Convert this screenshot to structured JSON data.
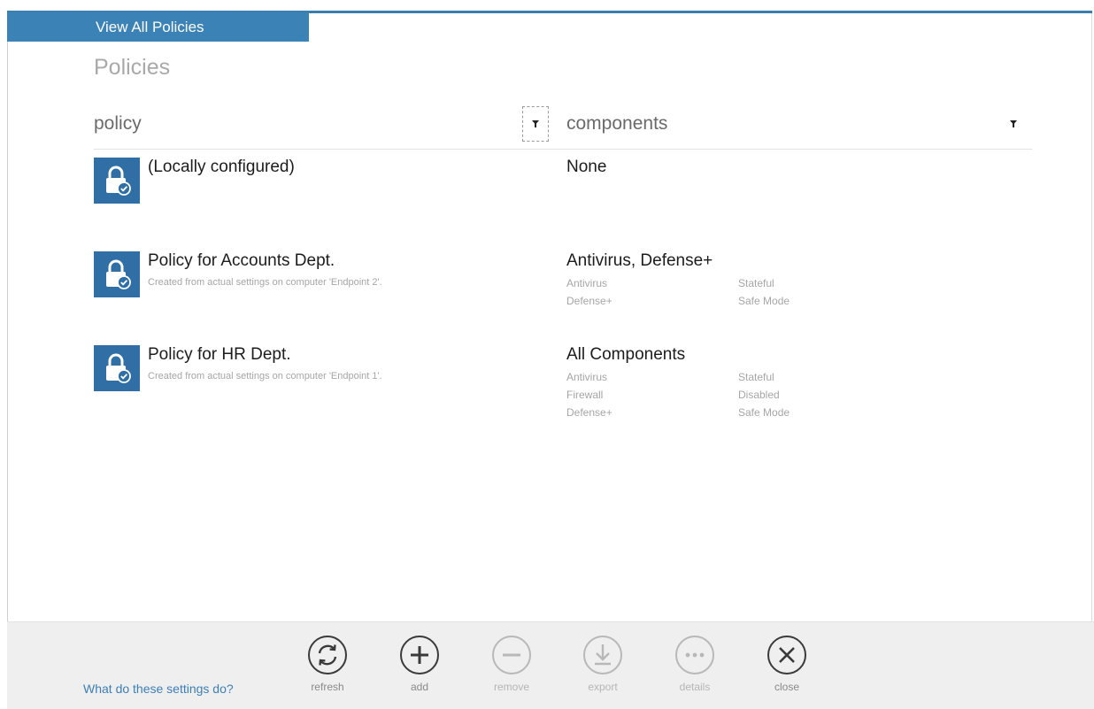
{
  "tab": {
    "label": "View All Policies"
  },
  "page": {
    "title": "Policies"
  },
  "columns": {
    "policy": "policy",
    "components": "components"
  },
  "policies": [
    {
      "name": "(Locally configured)",
      "subtitle": "",
      "components_summary": "None",
      "components": []
    },
    {
      "name": "Policy for Accounts Dept.",
      "subtitle": "Created from actual settings on computer 'Endpoint 2'.",
      "components_summary": "Antivirus, Defense+",
      "components": [
        {
          "name": "Antivirus",
          "state": "Stateful"
        },
        {
          "name": "Defense+",
          "state": "Safe Mode"
        }
      ]
    },
    {
      "name": "Policy for HR Dept.",
      "subtitle": "Created from actual settings on computer 'Endpoint 1'.",
      "components_summary": "All Components",
      "components": [
        {
          "name": "Antivirus",
          "state": "Stateful"
        },
        {
          "name": "Firewall",
          "state": "Disabled"
        },
        {
          "name": "Defense+",
          "state": "Safe Mode"
        }
      ]
    }
  ],
  "footer": {
    "help_link": "What do these settings do?",
    "actions": {
      "refresh": {
        "label": "refresh",
        "icon": "refresh-icon",
        "enabled": true
      },
      "add": {
        "label": "add",
        "icon": "plus-icon",
        "enabled": true
      },
      "remove": {
        "label": "remove",
        "icon": "minus-icon",
        "enabled": false
      },
      "export": {
        "label": "export",
        "icon": "download-icon",
        "enabled": false
      },
      "details": {
        "label": "details",
        "icon": "ellipsis-icon",
        "enabled": false
      },
      "close": {
        "label": "close",
        "icon": "close-icon",
        "enabled": true
      }
    }
  },
  "colors": {
    "accent": "#3b82b7",
    "tile": "#2f6fa6",
    "link": "#3b7fb8",
    "icon_enabled": "#3a3a3a",
    "icon_disabled": "#b8b8b8"
  }
}
